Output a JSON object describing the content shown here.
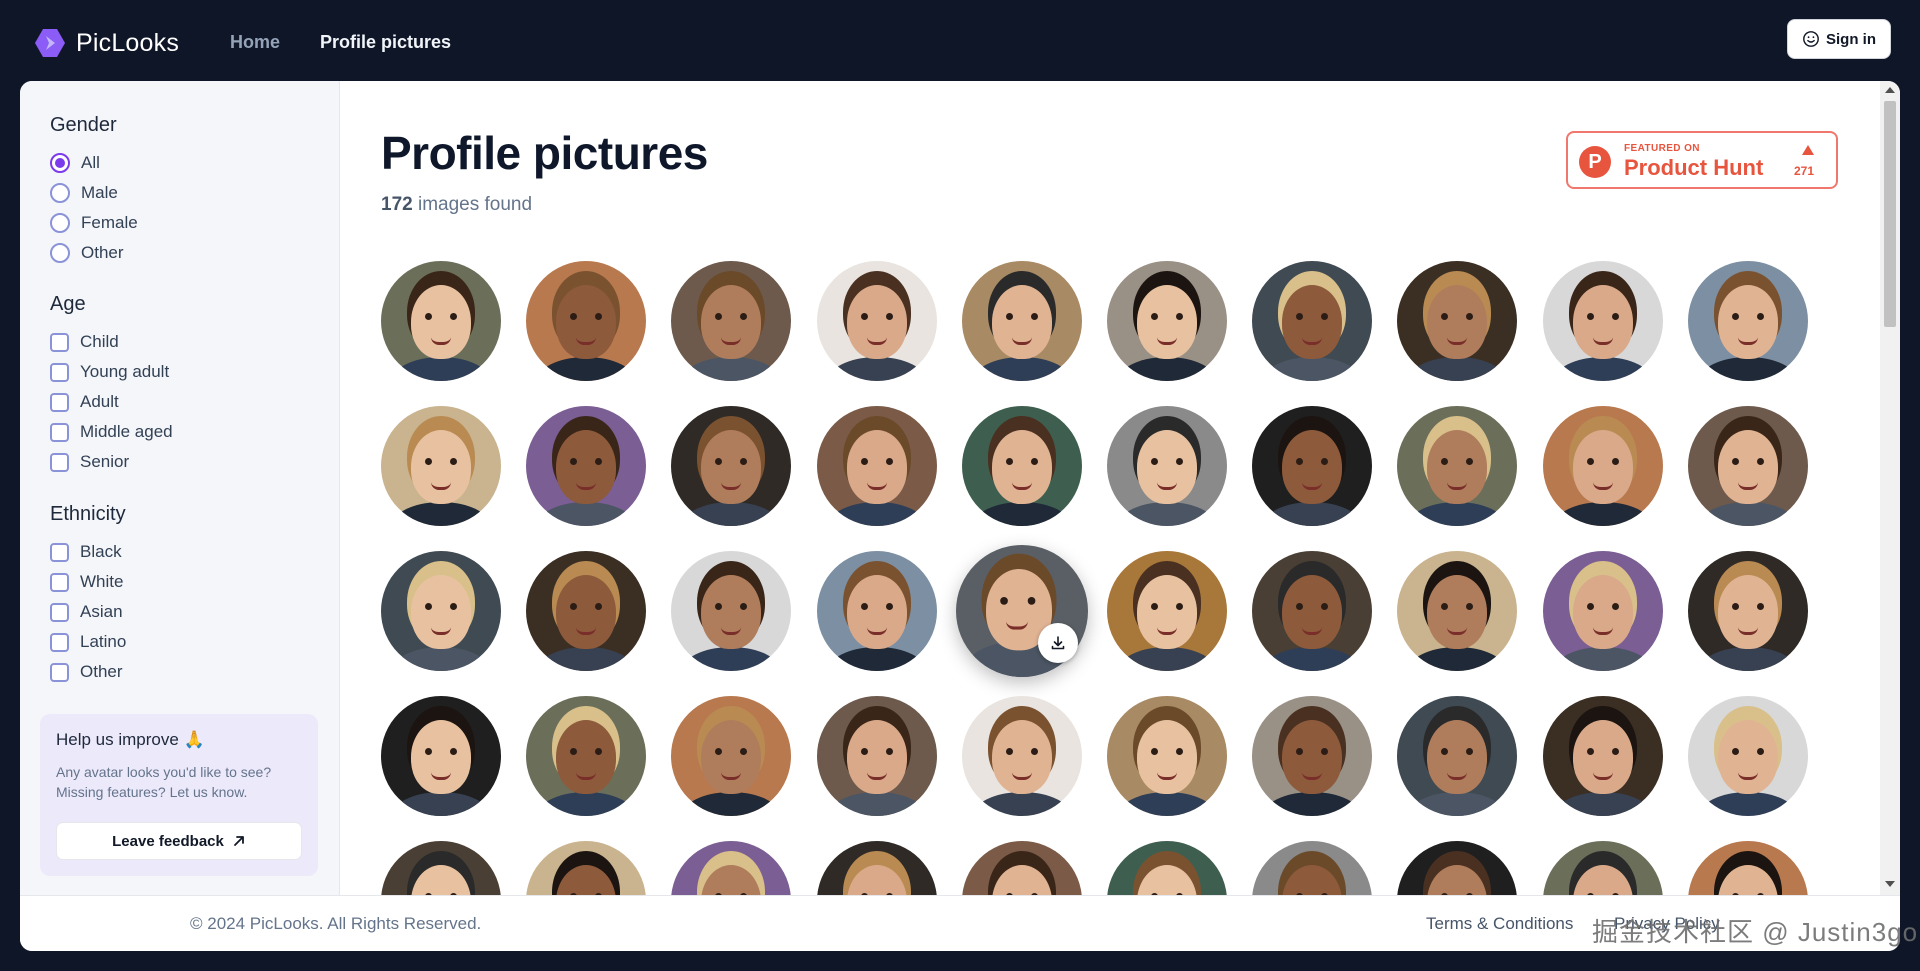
{
  "app": {
    "name": "PicLooks",
    "nav": [
      {
        "label": "Home",
        "active": false
      },
      {
        "label": "Profile pictures",
        "active": true
      }
    ],
    "signin_label": "Sign in"
  },
  "filters": {
    "gender": {
      "title": "Gender",
      "options": [
        "All",
        "Male",
        "Female",
        "Other"
      ],
      "selected": "All"
    },
    "age": {
      "title": "Age",
      "options": [
        "Child",
        "Young adult",
        "Adult",
        "Middle aged",
        "Senior"
      ]
    },
    "ethnicity": {
      "title": "Ethnicity",
      "options": [
        "Black",
        "White",
        "Asian",
        "Latino",
        "Other"
      ]
    }
  },
  "help": {
    "title": "Help us improve 🙏",
    "text": "Any avatar looks you'd like to see? Missing features? Let us know.",
    "button_label": "Leave feedback"
  },
  "main": {
    "title": "Profile pictures",
    "count_number": "172",
    "count_suffix": " images found"
  },
  "product_hunt": {
    "featured": "FEATURED ON",
    "name": "Product Hunt",
    "votes": "271",
    "logo_letter": "P"
  },
  "footer": {
    "copyright": "© 2024 PicLooks. All Rights Reserved.",
    "terms": "Terms & Conditions",
    "privacy": "Privacy Policy"
  },
  "watermark": "掘金技术社区 @ Justin3go",
  "colors": {
    "accent": "#7c3aed",
    "topbar": "#0f1628",
    "product_hunt": "#e8553f"
  },
  "icons": {
    "logo": "hexagon-logo-icon",
    "signin": "smiley-icon",
    "feedback": "arrow-up-right-icon",
    "download": "download-icon"
  }
}
